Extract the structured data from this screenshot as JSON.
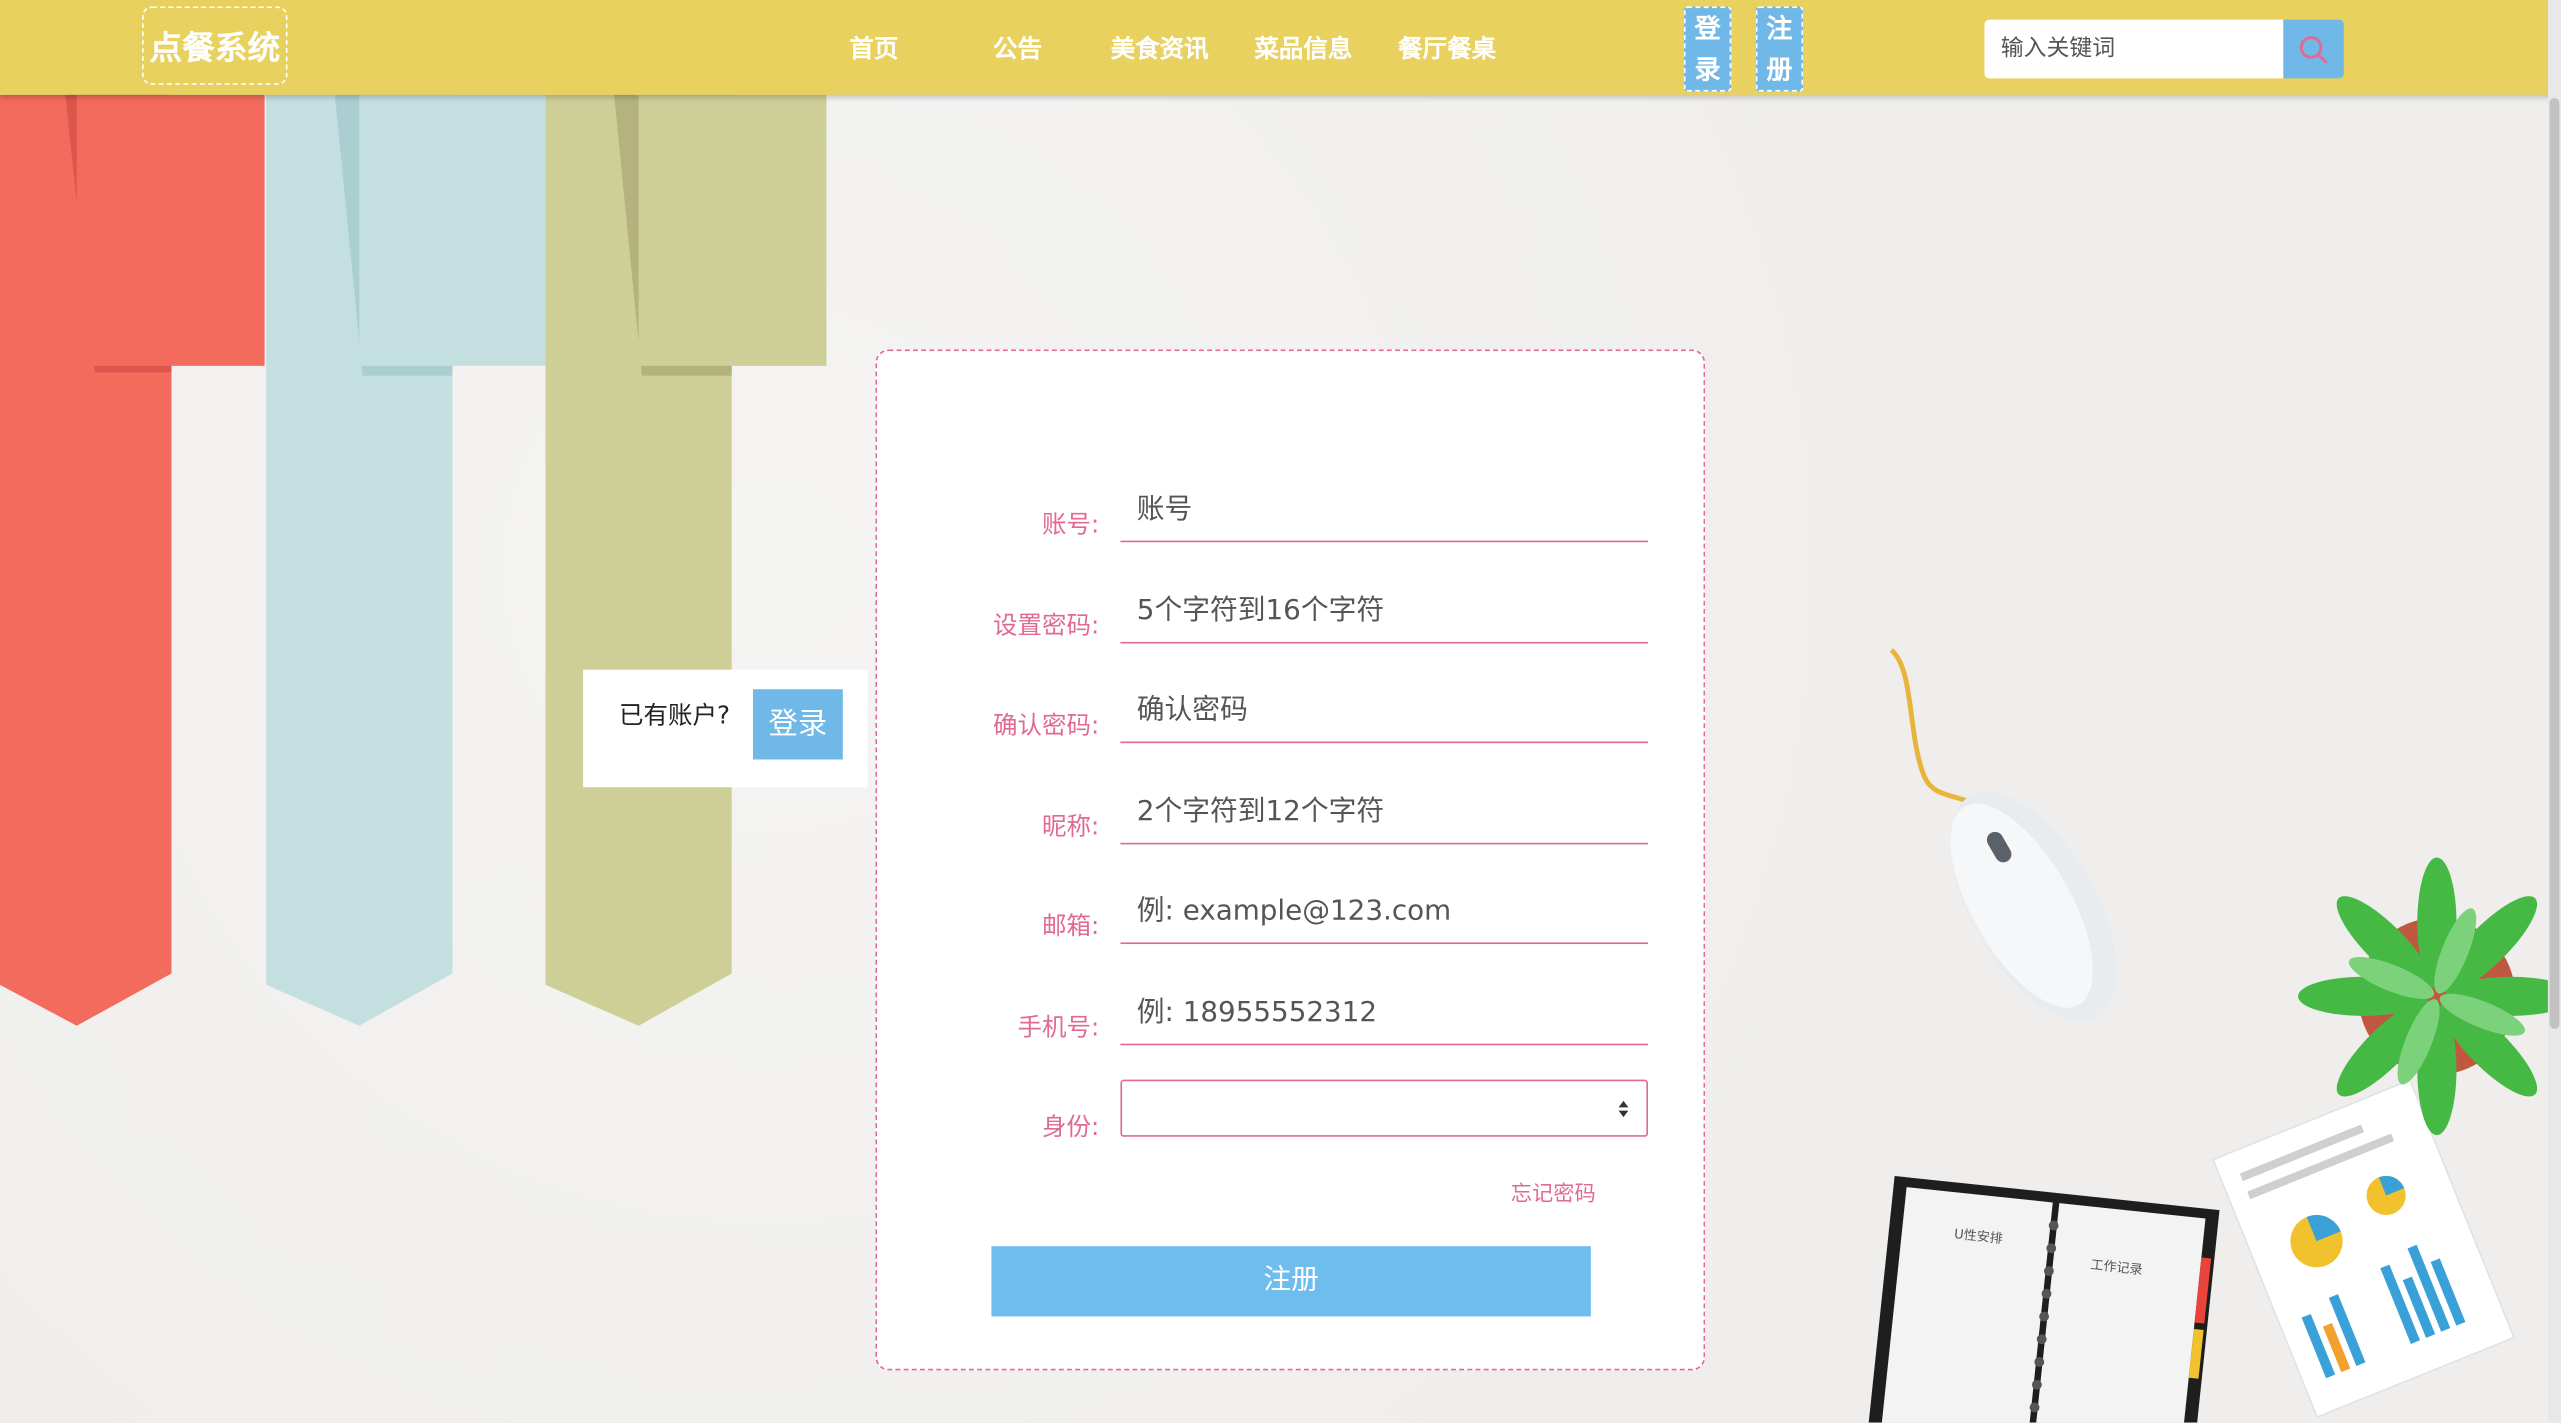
{
  "header": {
    "logo": "点餐系统",
    "nav": [
      "首页",
      "公告",
      "美食资讯",
      "菜品信息",
      "餐厅餐桌"
    ],
    "login_label": "登录",
    "login_chars": [
      "登",
      "录"
    ],
    "register_label": "注册",
    "register_chars": [
      "注",
      "册"
    ],
    "search_placeholder": "输入关键词",
    "search_icon": "search-icon"
  },
  "side_panel": {
    "prompt": "已有账户?",
    "login_button": "登录"
  },
  "form": {
    "fields": [
      {
        "label": "账号:",
        "placeholder": "账号",
        "value": ""
      },
      {
        "label": "设置密码:",
        "placeholder": "5个字符到16个字符",
        "value": ""
      },
      {
        "label": "确认密码:",
        "placeholder": "确认密码",
        "value": ""
      },
      {
        "label": "昵称:",
        "placeholder": "2个字符到12个字符",
        "value": ""
      },
      {
        "label": "邮箱:",
        "placeholder": "例: example@123.com",
        "value": ""
      },
      {
        "label": "手机号:",
        "placeholder": "例: 18955552312",
        "value": ""
      }
    ],
    "identity_label": "身份:",
    "identity_value": "",
    "forgot_password": "忘记密码",
    "submit": "注册"
  },
  "decor": {
    "notebook_text_left": "U性安排",
    "notebook_text_right": "工作记录"
  },
  "colors": {
    "header_bg": "#e8d15e",
    "accent_blue": "#6fb8e8",
    "accent_pink": "#e06a93",
    "ribbon_red": "#f26b5c",
    "ribbon_blue": "#c3dfe0",
    "ribbon_olive": "#cece97"
  }
}
